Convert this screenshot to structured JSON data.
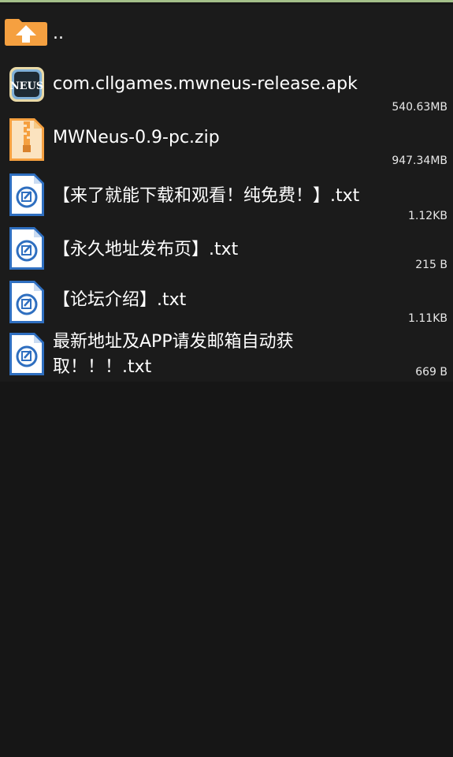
{
  "parent": {
    "label": ".."
  },
  "files": [
    {
      "name": "com.cllgames.mwneus-release.apk",
      "size": "540.63MB",
      "icon": "apk-app-icon",
      "icon_text": "NEUS"
    },
    {
      "name": "MWNeus-0.9-pc.zip",
      "size": "947.34MB",
      "icon": "zip-archive-icon"
    },
    {
      "name": "【来了就能下载和观看！纯免费！】.txt",
      "size": "1.12KB",
      "icon": "text-file-icon"
    },
    {
      "name": "【永久地址发布页】.txt",
      "size": "215 B",
      "icon": "text-file-icon"
    },
    {
      "name": "【论坛介绍】.txt",
      "size": "1.11KB",
      "icon": "text-file-icon"
    },
    {
      "name": "最新地址及APP请发邮箱自动获取！！！.txt",
      "size": "669 B",
      "icon": "text-file-icon"
    }
  ],
  "colors": {
    "background": "#161616",
    "list_background": "#1b1b1b",
    "accent_orange": "#f5a040",
    "text_icon_blue": "#2f6fc0",
    "top_line": "#a4c08a"
  }
}
